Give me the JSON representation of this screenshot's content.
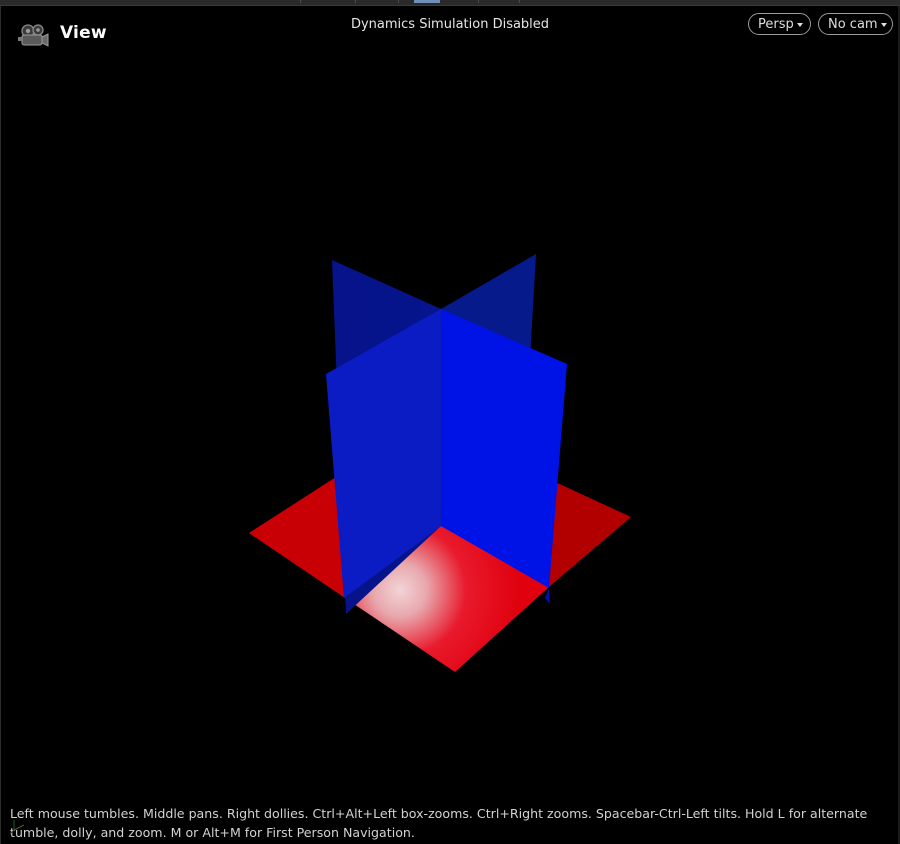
{
  "viewport": {
    "title": "View",
    "status_text": "Dynamics Simulation Disabled",
    "projection_menu": {
      "label": "Persp"
    },
    "camera_menu": {
      "label": "No cam"
    },
    "navigation_hint": "Left mouse tumbles. Middle pans. Right dollies. Ctrl+Alt+Left box-zooms. Ctrl+Right zooms. Spacebar-Ctrl-Left tilts. Hold L for alternate tumble, dolly, and zoom. M or Alt+M for First Person Navigation."
  },
  "icons": {
    "camera": "camera-icon",
    "axes": "axes-indicator-icon",
    "dropdown": "chevron-down-icon"
  },
  "colors": {
    "background": "#000000",
    "ground_plane": "#e0000e",
    "ground_highlight": "#f2c8cc",
    "wall_planes": "#0000ee",
    "title_text": "#ffffff",
    "status_text": "#e6e6e6"
  }
}
